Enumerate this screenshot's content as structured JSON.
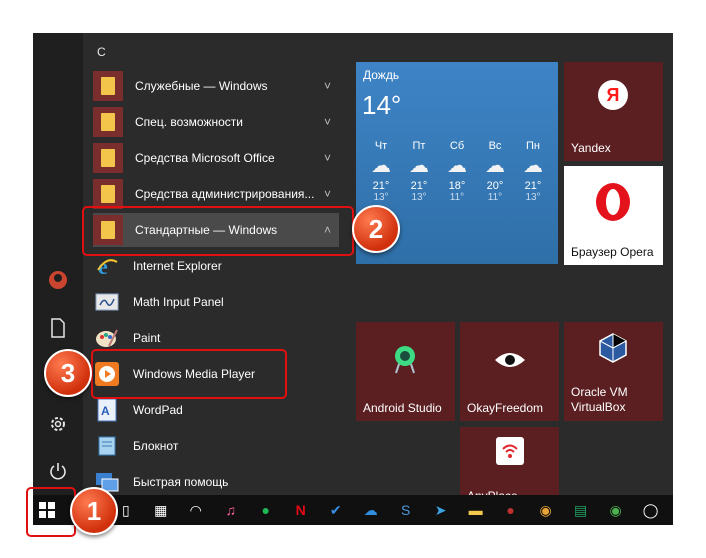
{
  "app_list": {
    "section_letter": "С",
    "items": [
      {
        "label": "Служебные — Windows",
        "chevron": "˅"
      },
      {
        "label": "Спец. возможности",
        "chevron": "˅"
      },
      {
        "label": "Средства Microsoft Office",
        "chevron": "˅"
      },
      {
        "label": "Средства администрирования...",
        "chevron": "˅"
      },
      {
        "label": "Стандартные — Windows",
        "chevron": "˄"
      },
      {
        "label": "Internet Explorer"
      },
      {
        "label": "Math Input Panel"
      },
      {
        "label": "Paint"
      },
      {
        "label": "Windows Media Player"
      },
      {
        "label": "WordPad"
      },
      {
        "label": "Блокнот"
      },
      {
        "label": "Быстрая помощь"
      }
    ]
  },
  "weather": {
    "city": "Дождь",
    "temp": "14°",
    "days": [
      {
        "day": "Чт",
        "hi": "21°",
        "lo": "13°"
      },
      {
        "day": "Пт",
        "hi": "21°",
        "lo": "13°"
      },
      {
        "day": "Сб",
        "hi": "18°",
        "lo": "11°"
      },
      {
        "day": "Вс",
        "hi": "20°",
        "lo": "11°"
      },
      {
        "day": "Пн",
        "hi": "21°",
        "lo": "13°"
      }
    ]
  },
  "tiles": {
    "yandex": "Yandex",
    "opera": "Браузер Opera",
    "android_studio": "Android Studio",
    "okayfreedom": "OkayFreedom",
    "oracle_vm": "Oracle VM VirtualBox",
    "anyplace": "AnyPlace"
  },
  "callouts": [
    "1",
    "2",
    "3"
  ],
  "colors": {
    "tile_bg": "#5b1f22",
    "weather_bg": "#3e84c6",
    "callout": "#e0451b",
    "highlight": "#e01010"
  }
}
